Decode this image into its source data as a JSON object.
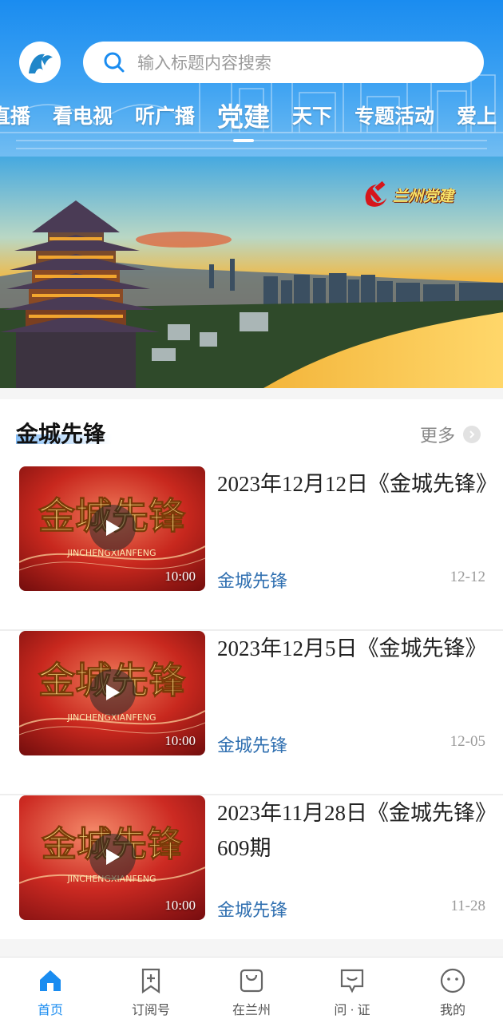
{
  "search": {
    "placeholder": "输入标题内容搜索"
  },
  "tabs": [
    {
      "label": "直播"
    },
    {
      "label": "看电视"
    },
    {
      "label": "听广播"
    },
    {
      "label": "党建",
      "active": true
    },
    {
      "label": "天下"
    },
    {
      "label": "专题活动"
    },
    {
      "label": "爱上"
    }
  ],
  "banner": {
    "label": "兰州党建"
  },
  "section": {
    "title": "金城先锋",
    "more": "更多",
    "articles": [
      {
        "title": "2023年12月12日《金城先锋》",
        "source": "金城先锋",
        "date": "12-12",
        "duration": "10:00",
        "thumb_text": "金城先锋",
        "thumb_sub": "JINCHENGXIANFENG"
      },
      {
        "title": "2023年12月5日《金城先锋》",
        "source": "金城先锋",
        "date": "12-05",
        "duration": "10:00",
        "thumb_text": "金城先锋",
        "thumb_sub": "JINCHENGXIANFENG"
      },
      {
        "title": "2023年11月28日《金城先锋》609期",
        "source": "金城先锋",
        "date": "11-28",
        "duration": "10:00",
        "thumb_text": "金城先锋",
        "thumb_sub": "JINCHENGXIANFENG"
      }
    ]
  },
  "bottom_nav": [
    {
      "label": "首页",
      "icon": "home-icon",
      "active": true
    },
    {
      "label": "订阅号",
      "icon": "bookmark-add-icon"
    },
    {
      "label": "在兰州",
      "icon": "bag-icon"
    },
    {
      "label": "问 · 证",
      "icon": "chat-icon"
    },
    {
      "label": "我的",
      "icon": "profile-face-icon"
    }
  ],
  "colors": {
    "accent": "#1a8cf0",
    "source_text": "#2f6fb0",
    "date_text": "#9a9a9a"
  }
}
